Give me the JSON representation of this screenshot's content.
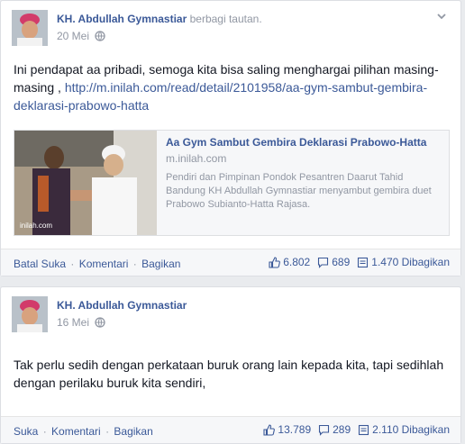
{
  "posts": [
    {
      "author": "KH. Abdullah Gymnastiar",
      "shared_text": "berbagi tautan.",
      "date": "20 Mei",
      "text": "Ini pendapat aa pribadi, semoga kita bisa saling menghargai pilihan masing-masing ,",
      "link": "http://m.inilah.com/read/detail/2101958/aa-gym-sambut-gembira-deklarasi-prabowo-hatta",
      "preview": {
        "title": "Aa Gym Sambut Gembira Deklarasi Prabowo-Hatta",
        "domain": "m.inilah.com",
        "description": "Pendiri dan Pimpinan Pondok Pesantren Daarut Tahid Bandung KH Abdullah Gymnastiar menyambut gembira duet Prabowo Subianto-Hatta Rajasa.",
        "watermark": "inilah.com"
      },
      "actions": [
        "Batal Suka",
        "Komentari",
        "Bagikan"
      ],
      "likes": "6.802",
      "comments": "689",
      "shares": "1.470 Dibagikan"
    },
    {
      "author": "KH. Abdullah Gymnastiar",
      "date": "16 Mei",
      "text": "Tak perlu sedih dengan perkataan buruk orang lain kepada kita, tapi sedihlah dengan perilaku buruk kita sendiri,",
      "actions": [
        "Suka",
        "Komentari",
        "Bagikan"
      ],
      "likes": "13.789",
      "comments": "289",
      "shares": "2.110 Dibagikan"
    }
  ],
  "icons": {
    "globe": "globe-icon",
    "chevron": "chevron-down-icon",
    "like": "thumbs-up-icon",
    "comment": "comment-icon",
    "share": "share-icon"
  },
  "colors": {
    "link": "#3b5998",
    "muted": "#9197a3",
    "background": "#e9ebee"
  }
}
